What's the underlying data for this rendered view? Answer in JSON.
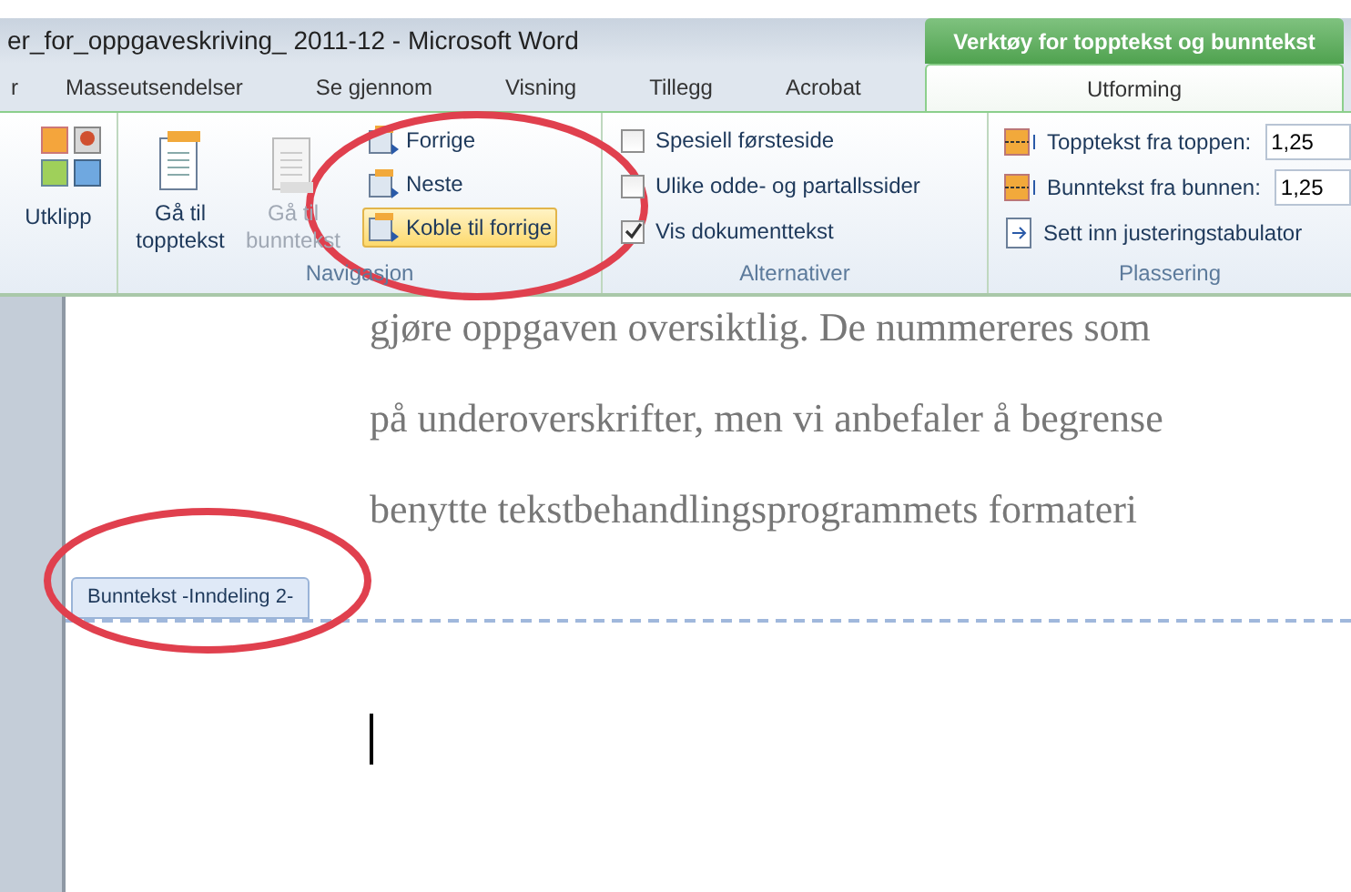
{
  "window": {
    "title": "er_for_oppgaveskriving_ 2011-12  -  Microsoft Word",
    "contextual_header": "Verktøy for topptekst og bunntekst"
  },
  "tabs": [
    {
      "label": "r",
      "selected": false
    },
    {
      "label": "Masseutsendelser",
      "selected": false
    },
    {
      "label": "Se gjennom",
      "selected": false
    },
    {
      "label": "Visning",
      "selected": false
    },
    {
      "label": "Tillegg",
      "selected": false
    },
    {
      "label": "Acrobat",
      "selected": false
    },
    {
      "label": "Utforming",
      "selected": true
    }
  ],
  "clipboard": {
    "label": "Utklipp"
  },
  "navigation": {
    "label": "Navigasjon",
    "large_buttons": [
      {
        "label": "Gå til topptekst",
        "disabled": false
      },
      {
        "label": "Gå til bunntekst",
        "disabled": true
      }
    ],
    "small_buttons": [
      {
        "label": "Forrige",
        "selected": false
      },
      {
        "label": "Neste",
        "selected": false
      },
      {
        "label": "Koble til forrige",
        "selected": true
      }
    ]
  },
  "options": {
    "label": "Alternativer",
    "checkboxes": [
      {
        "label": "Spesiell førsteside",
        "checked": false
      },
      {
        "label": "Ulike odde- og partallssider",
        "checked": false
      },
      {
        "label": "Vis dokumenttekst",
        "checked": true
      }
    ]
  },
  "position": {
    "label": "Plassering",
    "rows": [
      {
        "kind": "spinner",
        "label": "Topptekst fra toppen:",
        "value": "1,25"
      },
      {
        "kind": "spinner",
        "label": "Bunntekst fra bunnen:",
        "value": "1,25"
      },
      {
        "kind": "button",
        "label": "Sett inn justeringstabulator"
      }
    ]
  },
  "document": {
    "lines": [
      "gjøre oppgaven oversiktlig. De nummereres som",
      "på underoverskrifter, men vi anbefaler å begrense",
      "benytte tekstbehandlingsprogrammets formateri"
    ],
    "footer_tag": "Bunntekst -Inndeling 2-"
  }
}
